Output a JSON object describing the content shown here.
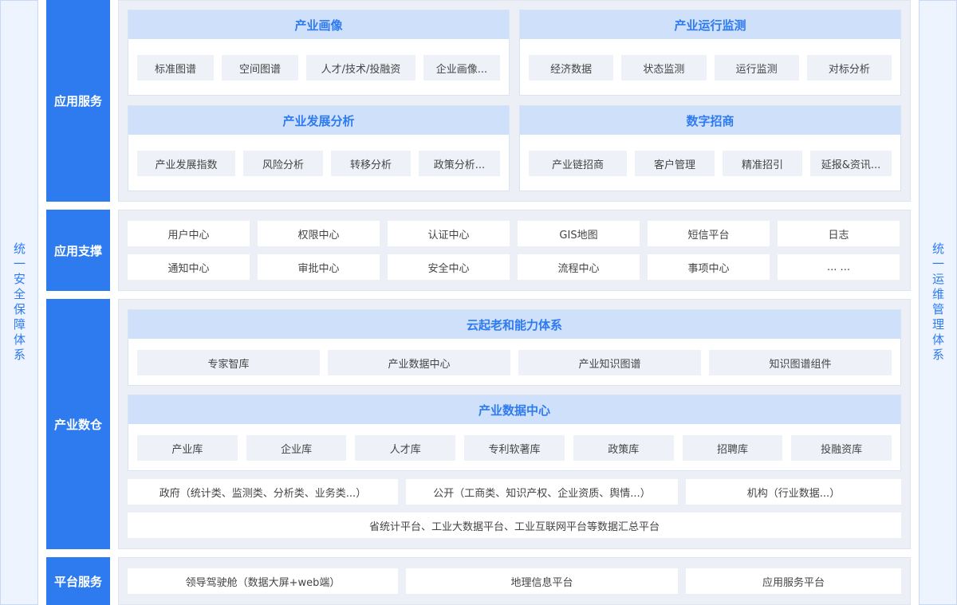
{
  "side": {
    "left": "统一安全保障体系",
    "right": "统一运维管理体系"
  },
  "layers": {
    "app_service": {
      "label": "应用服务",
      "cards": [
        {
          "title": "产业画像",
          "items": [
            "标准图谱",
            "空间图谱",
            "人才/技术/投融资",
            "企业画像..."
          ]
        },
        {
          "title": "产业运行监测",
          "items": [
            "经济数据",
            "状态监测",
            "运行监测",
            "对标分析"
          ]
        },
        {
          "title": "产业发展分析",
          "items": [
            "产业发展指数",
            "风险分析",
            "转移分析",
            "政策分析..."
          ]
        },
        {
          "title": "数字招商",
          "items": [
            "产业链招商",
            "客户管理",
            "精准招引",
            "延报&资讯..."
          ]
        }
      ]
    },
    "app_support": {
      "label": "应用支撑",
      "rows": [
        [
          "用户中心",
          "权限中心",
          "认证中心",
          "GIS地图",
          "短信平台",
          "日志"
        ],
        [
          "通知中心",
          "审批中心",
          "安全中心",
          "流程中心",
          "事项中心",
          "... ..."
        ]
      ]
    },
    "warehouse": {
      "label": "产业数仓",
      "card1": {
        "title": "云起老和能力体系",
        "items": [
          "专家智库",
          "产业数据中心",
          "产业知识图谱",
          "知识图谱组件"
        ]
      },
      "card2": {
        "title": "产业数据中心",
        "items": [
          "产业库",
          "企业库",
          "人才库",
          "专利软著库",
          "政策库",
          "招聘库",
          "投融资库"
        ]
      },
      "sources": [
        "政府（统计类、监测类、分析类、业务类...）",
        "公开（工商类、知识产权、企业资质、舆情...）",
        "机构（行业数据...）"
      ],
      "platform": "省统计平台、工业大数据平台、工业互联网平台等数据汇总平台"
    },
    "platform_service": {
      "label": "平台服务",
      "items": [
        "领导驾驶舱（数据大屏+web端）",
        "地理信息平台",
        "应用服务平台"
      ]
    }
  }
}
